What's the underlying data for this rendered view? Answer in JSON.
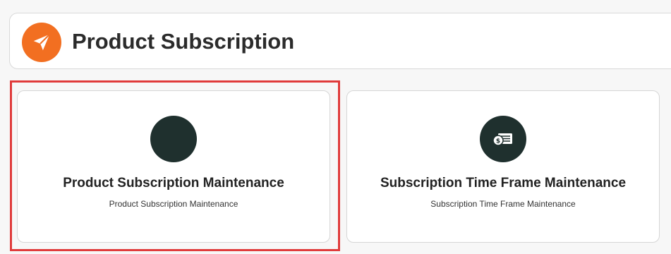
{
  "header": {
    "title": "Product Subscription",
    "icon": "paper-plane-icon",
    "icon_color": "#f26f21"
  },
  "tiles": [
    {
      "title": "Product Subscription Maintenance",
      "subtitle": "Product Subscription Maintenance",
      "icon": "blank-circle-icon",
      "icon_color": "#1f302e",
      "selected": true
    },
    {
      "title": "Subscription Time Frame Maintenance",
      "subtitle": "Subscription Time Frame Maintenance",
      "icon": "money-bills-icon",
      "icon_color": "#1f302e",
      "selected": false
    }
  ],
  "colors": {
    "highlight": "#e03b3b",
    "background": "#f7f7f7"
  }
}
